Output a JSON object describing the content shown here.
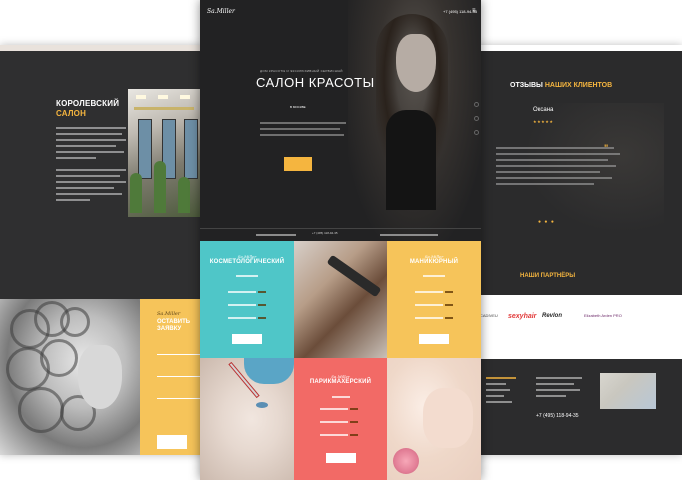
{
  "left": {
    "royal": {
      "title_main": "КОРОЛЕВСКИЙ",
      "title_accent": "САЛОН"
    },
    "form": {
      "logo": "Sa.Miller",
      "title": "ОСТАВИТЬ ЗАЯВКУ"
    }
  },
  "center": {
    "hero": {
      "logo": "Sa.Miller",
      "phone": "+7 (495) 118-94-35",
      "menu_icon": "≡",
      "subtitle": "ДОМ КРАСОТЫ И ЭКСКЛЮЗИВНЫЙ СЕРВИСНЫЙ",
      "title": "САЛОН КРАСОТЫ",
      "location": "В МОСКВЕ",
      "bar_phone": "+7 (495) 118-94-35"
    },
    "tiles": {
      "cosm": {
        "logo": "Sa.Miller",
        "title": "КОСМЕТОЛОГИЧЕСКИЙ"
      },
      "mani": {
        "logo": "Sa.Miller",
        "title": "МАНИКЮРНЫЙ"
      },
      "hairdress": {
        "logo": "Sa.Miller",
        "title": "ПАРИКМАХЕРСКИЙ"
      }
    }
  },
  "right": {
    "reviews": {
      "title_main": "ОТЗЫВЫ",
      "title_accent": "НАШИХ КЛИЕНТОВ",
      "name": "Оксана",
      "stars": "★★★★★",
      "quote_mark": "\"",
      "dots": "● ● ●"
    },
    "partners": {
      "title": "НАШИ ПАРТНЁРЫ",
      "logos": [
        "CADIVEU",
        "sexyhair",
        "Revlon",
        "Elizabeth Arden PRO"
      ]
    },
    "footer": {
      "phone": "+7 (495) 118-94-35"
    }
  },
  "colors": {
    "accent": "#f5b53f",
    "dark": "#2b2b2c",
    "teal": "#4fc6c8",
    "coral": "#f26a66",
    "yellow": "#f6c45a"
  }
}
